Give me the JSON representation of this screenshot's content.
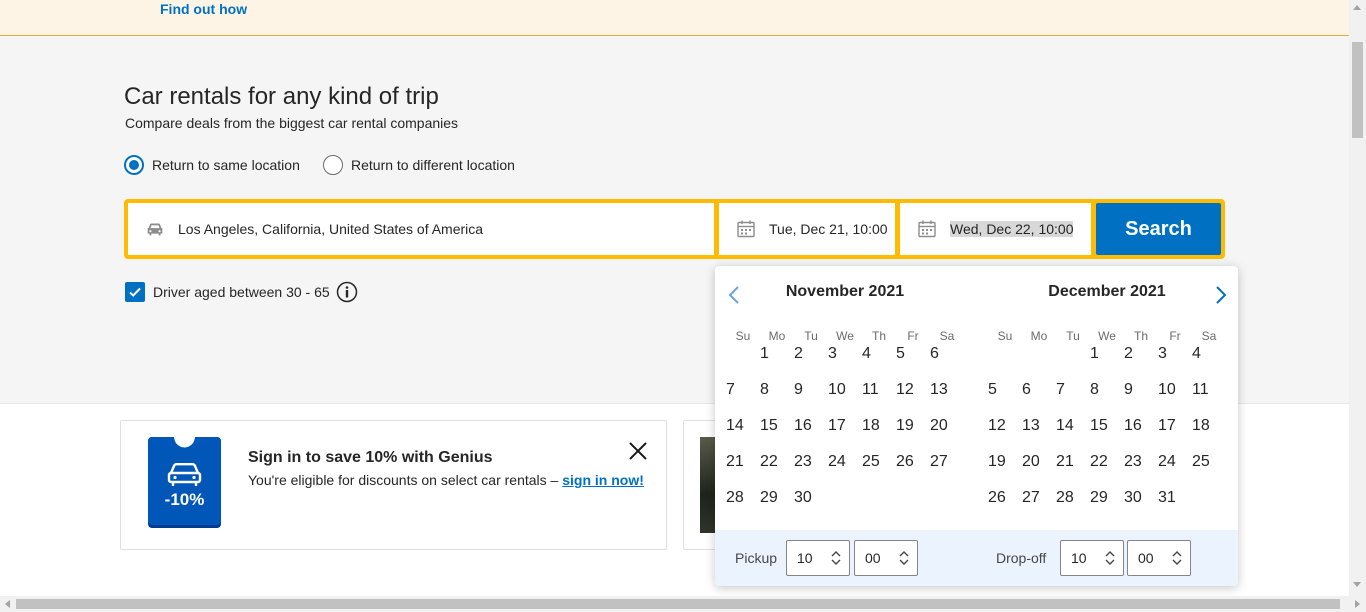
{
  "banner": {
    "link": "Find out how"
  },
  "hero": {
    "title": "Car rentals for any kind of trip",
    "subtitle": "Compare deals from the biggest car rental companies"
  },
  "radios": [
    {
      "label": "Return to same location",
      "checked": true
    },
    {
      "label": "Return to different location",
      "checked": false
    }
  ],
  "search": {
    "location": "Los Angeles, California, United States of America",
    "pickup": "Tue, Dec 21, 10:00",
    "dropoff": "Wed, Dec 22, 10:00",
    "button": "Search"
  },
  "driver": {
    "label": "Driver aged between 30 - 65",
    "checked": true
  },
  "genius": {
    "badge": "-10%",
    "title": "Sign in to save 10% with Genius",
    "desc": "You're eligible for discounts on select car rentals – ",
    "link": "sign in now!"
  },
  "calendar": {
    "dow": [
      "Su",
      "Mo",
      "Tu",
      "We",
      "Th",
      "Fr",
      "Sa"
    ],
    "months": [
      {
        "title": "November 2021",
        "offset": 1,
        "days": 30,
        "disabled_before": 19,
        "today": 19
      },
      {
        "title": "December 2021",
        "offset": 3,
        "days": 31,
        "selected": [
          21,
          22
        ]
      }
    ],
    "pickup_label": "Pickup",
    "dropoff_label": "Drop-off",
    "pickup_hour": "10",
    "pickup_min": "00",
    "dropoff_hour": "10",
    "dropoff_min": "00"
  },
  "colors": {
    "brand": "#0071c2",
    "accent": "#febb02",
    "banner": "#fdf4e6"
  }
}
